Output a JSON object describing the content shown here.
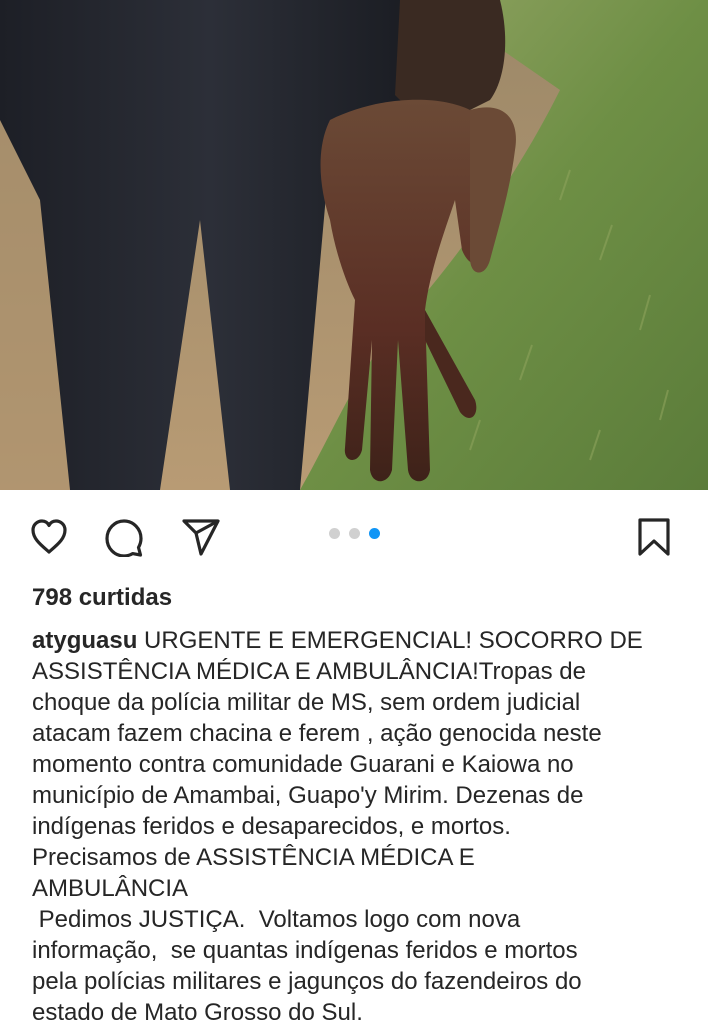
{
  "post": {
    "photo_alt": "",
    "carousel": {
      "count": 3,
      "active_index": 2,
      "accent_color": "#0f95f6",
      "inactive_color": "#d0d0d0"
    },
    "icons": {
      "like": "heart-icon",
      "comment": "comment-bubble-icon",
      "share": "paper-plane-icon",
      "save": "bookmark-icon"
    },
    "likes_text": "798 curtidas",
    "caption": {
      "username": "atyguasu",
      "first_line_rest": " URGENTE E EMERGENCIAL! SOCORRO DE",
      "lines": [
        "ASSISTÊNCIA MÉDICA E AMBULÂNCIA!Tropas de",
        "choque da polícia militar de MS, sem ordem judicial",
        "atacam fazem chacina e ferem , ação genocida neste",
        "momento contra comunidade Guarani e Kaiowa no",
        "município de Amambai,  Guapo'y Mirim. Dezenas de",
        "indígenas feridos e desaparecidos, e mortos.",
        "Precisamos de ASSISTÊNCIA MÉDICA  E",
        "AMBULÂNCIA"
      ],
      "paragraph2": [
        " Pedimos JUSTIÇA.  Voltamos logo com nova",
        "informação,  se quantas indígenas feridos e mortos",
        "pela polícias militares e jagunços do fazendeiros do",
        "estado de Mato Grosso do Sul."
      ]
    }
  }
}
